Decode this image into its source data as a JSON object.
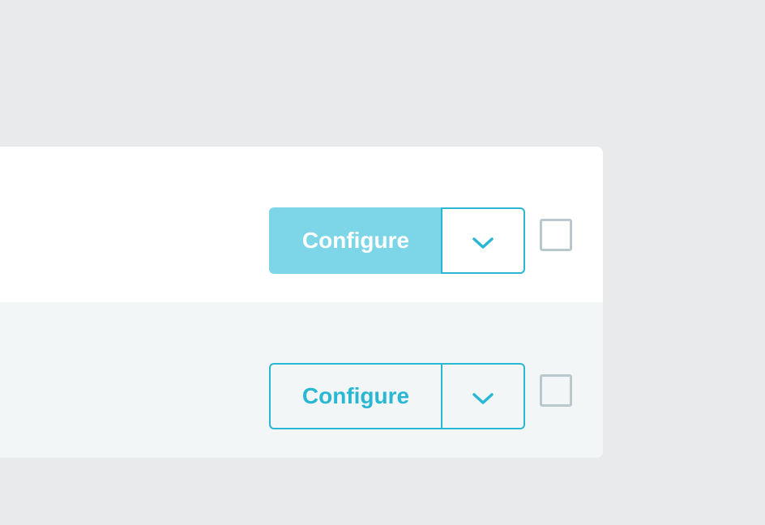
{
  "rows": [
    {
      "configure_label": "Configure",
      "configure_style": "filled",
      "dropdown_icon": "chevron-down-icon",
      "checkbox_checked": false
    },
    {
      "configure_label": "Configure",
      "configure_style": "outline",
      "dropdown_icon": "chevron-down-icon",
      "checkbox_checked": false
    }
  ],
  "colors": {
    "page_background": "#e9eaec",
    "accent": "#29b7d3",
    "accent_light": "#7dd5e8",
    "row_alt_background": "#f3f6f7",
    "checkbox_border": "#b9c8cd"
  }
}
